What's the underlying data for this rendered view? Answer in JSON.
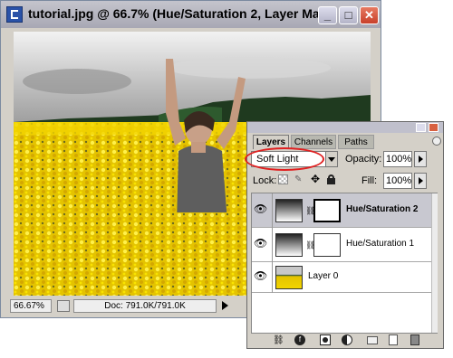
{
  "doc_window": {
    "title": "tutorial.jpg @ 66.7% (Hue/Saturation 2, Layer Mas...",
    "zoom": "66.67%",
    "doc_size": "Doc: 791.0K/791.0K",
    "buttons": {
      "minimize": "_",
      "maximize": "□",
      "close": "✕"
    }
  },
  "layers_panel": {
    "tabs": [
      "Layers",
      "Channels",
      "Paths"
    ],
    "active_tab": "Layers",
    "blend_mode": "Soft Light",
    "opacity_label": "Opacity:",
    "opacity_value": "100%",
    "lock_label": "Lock:",
    "fill_label": "Fill:",
    "fill_value": "100%",
    "layers": [
      {
        "name": "Hue/Saturation 2",
        "selected": true
      },
      {
        "name": "Hue/Saturation 1",
        "selected": false
      },
      {
        "name": "Layer 0",
        "selected": false
      }
    ]
  },
  "colors": {
    "highlight_ellipse": "#e02020",
    "selected_layer_bg": "#c8c8d0",
    "field_yellow": "#f2d400"
  },
  "icons": [
    "eye-icon",
    "chain-icon",
    "link-icon",
    "fx-icon",
    "mask-icon",
    "adjustment-icon",
    "folder-icon",
    "new-layer-icon",
    "trash-icon"
  ]
}
